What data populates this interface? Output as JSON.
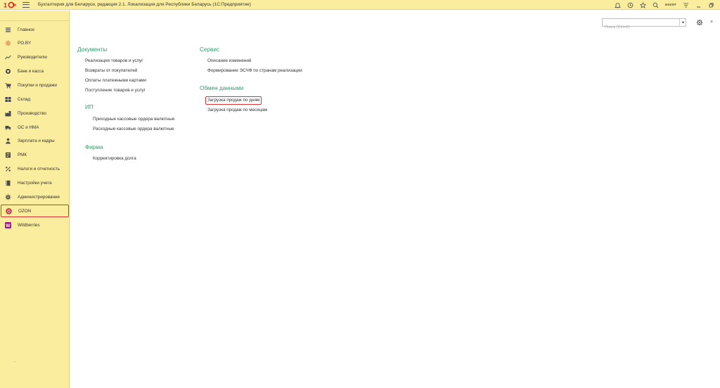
{
  "window": {
    "title": "Бухгалтерия для Беларуси, редакция 2.1. Локализация для Республики Беларусь   (1С:Предприятие)",
    "user": "аналит",
    "logo_text": "1С"
  },
  "sidebar": {
    "items": [
      {
        "label": "Главное",
        "icon": "list-icon"
      },
      {
        "label": "PO.BY",
        "icon": "sun-icon"
      },
      {
        "label": "Руководителю",
        "icon": "trend-icon"
      },
      {
        "label": "Банк и касса",
        "icon": "coin-icon"
      },
      {
        "label": "Покупки и продажи",
        "icon": "cart-icon"
      },
      {
        "label": "Склад",
        "icon": "warehouse-icon"
      },
      {
        "label": "Производство",
        "icon": "factory-icon"
      },
      {
        "label": "ОС и НМА",
        "icon": "truck-icon"
      },
      {
        "label": "Зарплата и кадры",
        "icon": "person-icon"
      },
      {
        "label": "РМК",
        "icon": "register-icon"
      },
      {
        "label": "Налоги и отчетность",
        "icon": "percent-icon"
      },
      {
        "label": "Настройки учета",
        "icon": "book-icon"
      },
      {
        "label": "Администрирование",
        "icon": "gear-icon"
      },
      {
        "label": "OZON",
        "icon": "ozon-icon"
      },
      {
        "label": "Wildberries",
        "icon": "wildberries-icon"
      }
    ],
    "highlighted": "OZON",
    "footer": "-"
  },
  "search": {
    "placeholder": "Поиск (Ctrl+F)"
  },
  "content": {
    "documents": {
      "title": "Документы",
      "links": [
        "Реализация товаров и услуг",
        "Возвраты от покупателей",
        "Оплаты платежными картами",
        "Поступление товаров и услуг"
      ]
    },
    "ip": {
      "title": "ИП",
      "links": [
        "Приходные кассовые ордера валютные",
        "Расходные кассовые ордера валютные"
      ]
    },
    "firma": {
      "title": "Фирма",
      "links": [
        "Корректировка долга"
      ]
    },
    "service": {
      "title": "Сервис",
      "links": [
        "Описание изменений",
        "Формирование ЭСЧФ по странам реализации"
      ]
    },
    "exchange": {
      "title": "Обмен данными",
      "links": [
        "Загрузка продаж по дням",
        "Загрузка продаж по месяцам"
      ],
      "highlighted": "Загрузка продаж по дням"
    }
  },
  "colors": {
    "sidebar_bg": "#fbed9e",
    "group_title": "#2f9e6b",
    "highlight_border": "#e03434"
  }
}
